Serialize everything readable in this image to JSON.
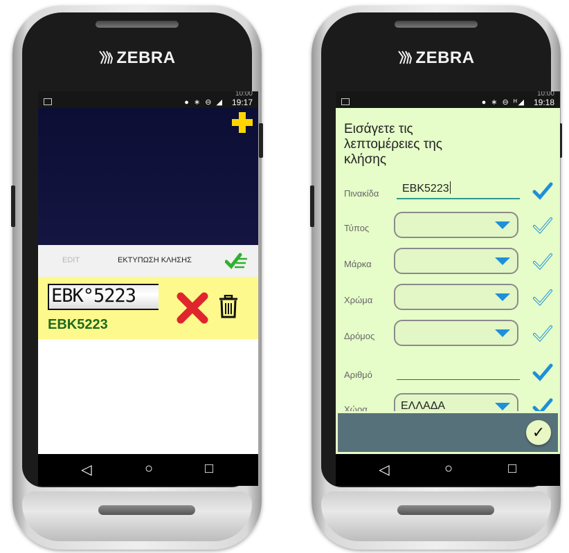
{
  "brand": "ZEBRA",
  "phone_left": {
    "status": {
      "ghost": "10:00",
      "time": "19:17",
      "icons": "● ∗ ⊖ ◢"
    },
    "camera_add_icon": "plus-icon",
    "tabs": {
      "edit": "EDIT",
      "print": "ΕΚΤΥΠΩΣΗ ΚΛΗΣΗΣ"
    },
    "plate_image_text": "EBK°5223",
    "plate_text": "EBK5223",
    "colors": {
      "accent": "#ffd600",
      "plate_bg": "#fdf98c",
      "plate_text": "#1d6b1d",
      "delete": "#e0262d"
    },
    "nav": {
      "back": "◁",
      "home": "○",
      "recent": "□"
    }
  },
  "phone_right": {
    "status": {
      "ghost": "10:00",
      "time": "19:18",
      "icons": "● ∗ ⊖ ᴴ◢"
    },
    "title": "Εισάγετε τις λεπτομέρειες της κλήσης",
    "fields": [
      {
        "label": "Πινακίδα",
        "value": "EBK5223",
        "type": "text",
        "checked": true
      },
      {
        "label": "Τύπος",
        "value": "",
        "type": "select",
        "checked": false
      },
      {
        "label": "Μάρκα",
        "value": "",
        "type": "select",
        "checked": false
      },
      {
        "label": "Χρώμα",
        "value": "",
        "type": "select",
        "checked": false
      },
      {
        "label": "Δρόμος",
        "value": "",
        "type": "select",
        "checked": false
      },
      {
        "label": "Αριθμό",
        "value": "",
        "type": "text",
        "checked": true
      },
      {
        "label": "Χώρα",
        "value": "ΕΛΛΑΔΑ",
        "type": "select",
        "checked": true
      }
    ],
    "submit_icon": "✓",
    "colors": {
      "form_bg": "#e6fcc9",
      "check": "#1e90d8",
      "bar": "#57717a"
    },
    "nav": {
      "back": "◁",
      "home": "○",
      "recent": "□"
    }
  }
}
